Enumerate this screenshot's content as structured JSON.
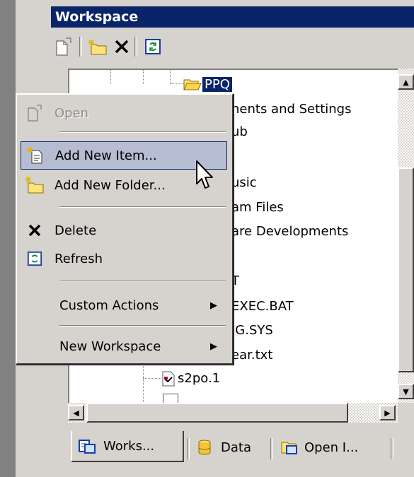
{
  "panel": {
    "title": "Workspace"
  },
  "toolbar": {
    "buttons": [
      "open-icon",
      "new-folder-icon",
      "delete-icon",
      "refresh-icon"
    ]
  },
  "tree": {
    "items": [
      {
        "label": "PPQ",
        "selected": true
      },
      {
        "label": "nents and Settings"
      },
      {
        "label": "ub"
      },
      {
        "label": "usic"
      },
      {
        "label": "am Files"
      },
      {
        "label": "are Developments"
      },
      {
        "label": "T"
      },
      {
        "label": "EXEC.BAT"
      },
      {
        "label": "IG.SYS"
      },
      {
        "label": "ear.txt"
      },
      {
        "label": "s2po.1"
      }
    ]
  },
  "context_menu": {
    "open": "Open",
    "add_new_item": "Add New Item...",
    "add_new_folder": "Add New Folder...",
    "delete": "Delete",
    "refresh": "Refresh",
    "custom_actions": "Custom Actions",
    "new_workspace": "New Workspace"
  },
  "tabs": [
    {
      "label": "Works...",
      "icon": "workspace-tab-icon",
      "active": true
    },
    {
      "label": "Data",
      "icon": "database-icon"
    },
    {
      "label": "Open I...",
      "icon": "open-items-icon"
    }
  ],
  "colors": {
    "title_bar": "#0a246a",
    "selection": "#0a246a",
    "menu_highlight": "#b6bdd2",
    "face": "#d6d3ce"
  }
}
